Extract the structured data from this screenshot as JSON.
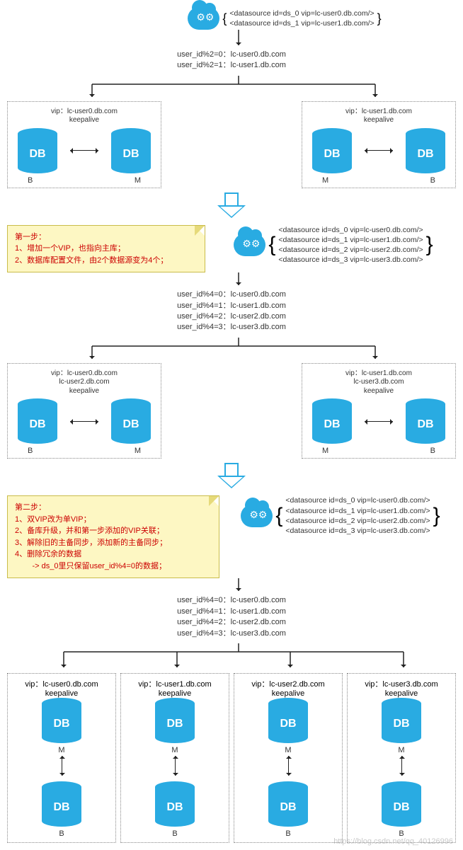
{
  "cloud1": {
    "sources": [
      "<datasource id=ds_0 vip=lc-user0.db.com/>",
      "<datasource id=ds_1 vip=lc-user1.db.com/>"
    ]
  },
  "routing1": [
    "user_id%2=0：lc-user0.db.com",
    "user_id%2=1：lc-user1.db.com"
  ],
  "pair1_left": {
    "vip": "vip：lc-user0.db.com",
    "keepalive": "keepalive",
    "left_role": "B",
    "right_role": "M"
  },
  "pair1_right": {
    "vip": "vip：lc-user1.db.com",
    "keepalive": "keepalive",
    "left_role": "M",
    "right_role": "B"
  },
  "note1": {
    "title": "第一步：",
    "lines": [
      "1、增加一个VIP，也指向主库；",
      "2、数据库配置文件，由2个数据源变为4个；"
    ]
  },
  "cloud2": {
    "sources": [
      "<datasource id=ds_0 vip=lc-user0.db.com/>",
      "<datasource id=ds_1 vip=lc-user1.db.com/>",
      "<datasource id=ds_2 vip=lc-user2.db.com/>",
      "<datasource id=ds_3 vip=lc-user3.db.com/>"
    ]
  },
  "routing2": [
    "user_id%4=0：lc-user0.db.com",
    "user_id%4=1：lc-user1.db.com",
    "user_id%4=2：lc-user2.db.com",
    "user_id%4=3：lc-user3.db.com"
  ],
  "pair2_left": {
    "vip1": "vip：lc-user0.db.com",
    "vip2": "lc-user2.db.com",
    "keepalive": "keepalive",
    "left_role": "B",
    "right_role": "M"
  },
  "pair2_right": {
    "vip1": "vip：lc-user1.db.com",
    "vip2": "lc-user3.db.com",
    "keepalive": "keepalive",
    "left_role": "M",
    "right_role": "B"
  },
  "note2": {
    "title": "第二步：",
    "lines": [
      "1、双VIP改为单VIP；",
      "2、备库升级，并和第一步添加的VIP关联；",
      "3、解除旧的主备同步，添加新的主备同步；",
      "4、删除冗余的数据",
      "        -> ds_0里只保留user_id%4=0的数据；"
    ]
  },
  "cloud3": {
    "sources": [
      "<datasource id=ds_0 vip=lc-user0.db.com/>",
      "<datasource id=ds_1 vip=lc-user1.db.com/>",
      "<datasource id=ds_2 vip=lc-user2.db.com/>",
      "<datasource id=ds_3 vip=lc-user3.db.com/>"
    ]
  },
  "routing3": [
    "user_id%4=0：lc-user0.db.com",
    "user_id%4=1：lc-user1.db.com",
    "user_id%4=2：lc-user2.db.com",
    "user_id%4=3：lc-user3.db.com"
  ],
  "quad": [
    {
      "vip": "vip：lc-user0.db.com",
      "keepalive": "keepalive",
      "top_role": "M",
      "bottom_role": "B"
    },
    {
      "vip": "vip：lc-user1.db.com",
      "keepalive": "keepalive",
      "top_role": "M",
      "bottom_role": "B"
    },
    {
      "vip": "vip：lc-user2.db.com",
      "keepalive": "keepalive",
      "top_role": "M",
      "bottom_role": "B"
    },
    {
      "vip": "vip：lc-user3.db.com",
      "keepalive": "keepalive",
      "top_role": "M",
      "bottom_role": "B"
    }
  ],
  "db_label": "DB",
  "watermark": "https://blog.csdn.net/qq_40126996"
}
